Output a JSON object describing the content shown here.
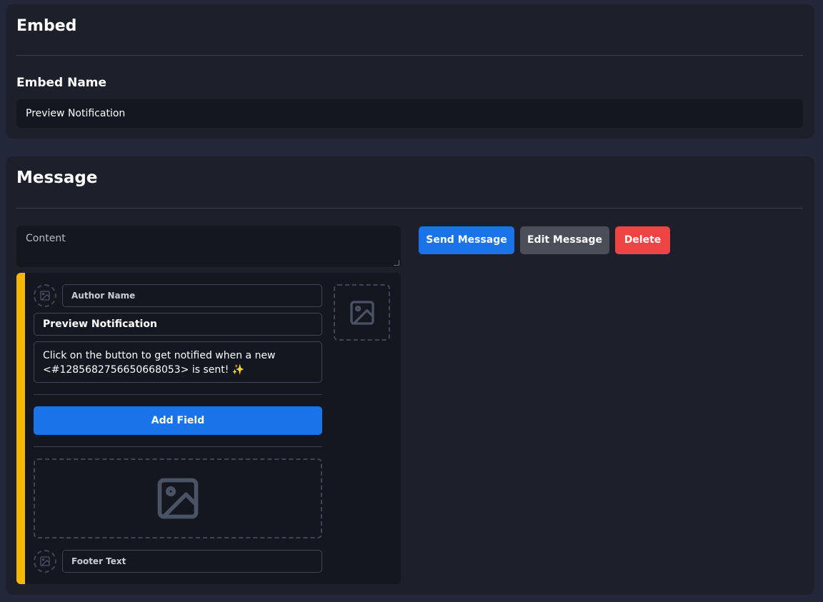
{
  "embed_section": {
    "title": "Embed",
    "name_label": "Embed Name",
    "name_value": "Preview Notification"
  },
  "message_section": {
    "title": "Message",
    "content_placeholder": "Content",
    "buttons": {
      "send": "Send Message",
      "edit": "Edit Message",
      "delete": "Delete"
    },
    "embed": {
      "stripe_color": "#f5b800",
      "author_placeholder": "Author Name",
      "title_value": "Preview Notification",
      "description_value": "Click on the button to get notified when a new <#1285682756650668053> is sent! ✨",
      "add_field_label": "Add Field",
      "footer_placeholder": "Footer Text"
    }
  },
  "colors": {
    "primary": "#1a73e8",
    "secondary": "#4a4e59",
    "danger": "#ef4444",
    "accent": "#f5b800"
  }
}
